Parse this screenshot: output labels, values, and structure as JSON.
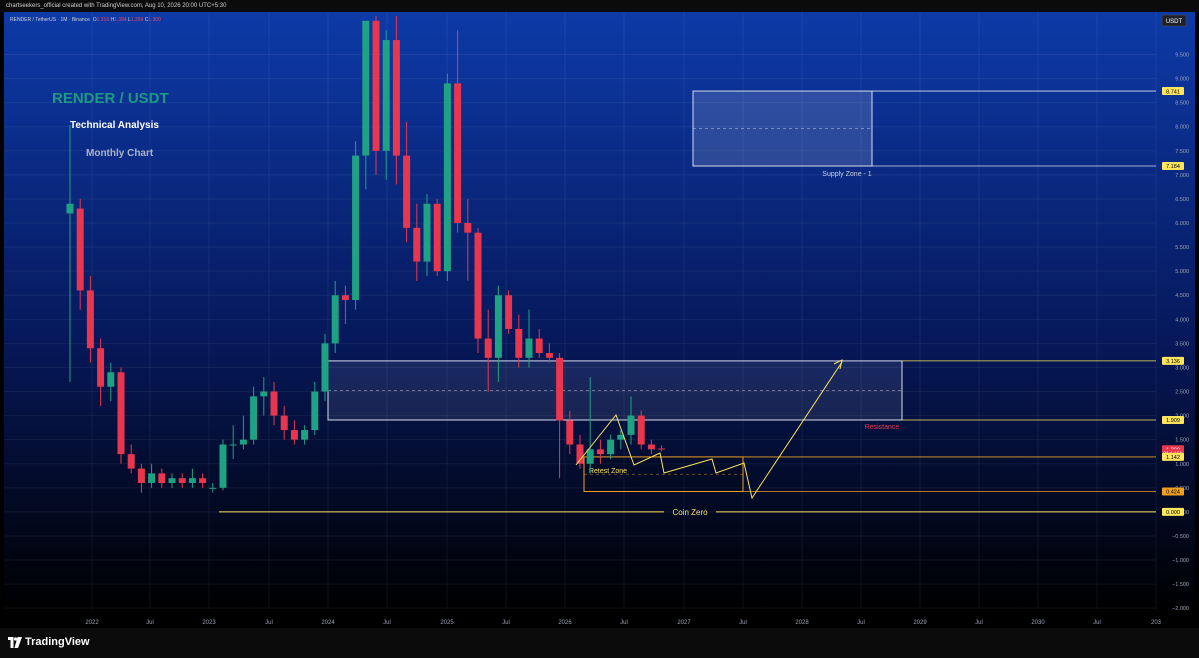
{
  "header": {
    "credit": "chartseekers_official created with TradingView.com, Aug 10, 2026 20:00 UTC+5:30",
    "symbol": "RENDER / TetherUS · 1M · Binance",
    "ohlc": {
      "O": "1.316",
      "H": "1.384",
      "L": "1.259",
      "C": "1.300"
    }
  },
  "overlay": {
    "title": "RENDER / USDT",
    "subtitle": "Technical Analysis",
    "period": "Monthly Chart"
  },
  "footer": {
    "brand": "TradingView"
  },
  "colors": {
    "up": "#1fa183",
    "down": "#e8364f",
    "drawing": "#ffe45c",
    "zone_border": "#d8dcea",
    "bg_top": "#0d3aa8",
    "bg_bottom": "#000000"
  },
  "chart_data": {
    "type": "candlestick",
    "currency_label": "USDT",
    "y_range": [
      -2.1,
      10.3
    ],
    "y_ticks": [
      "9.500",
      "9.000",
      "8.500",
      "8.000",
      "7.500",
      "7.000",
      "6.500",
      "6.000",
      "5.500",
      "5.000",
      "4.500",
      "4.000",
      "3.500",
      "3.000",
      "2.500",
      "2.000",
      "1.500",
      "1.000",
      "0.500",
      "0.000",
      "−0.500",
      "−1.000",
      "−1.500",
      "−2.000"
    ],
    "x_ticks": [
      "2022",
      "Jul",
      "2023",
      "Jul",
      "2024",
      "Jul",
      "2025",
      "Jul",
      "2026",
      "Jul",
      "2027",
      "Jul",
      "2028",
      "Jul",
      "2029",
      "Jul",
      "2030",
      "Jul",
      "203"
    ],
    "candles": [
      {
        "o": 6.2,
        "h": 7.9,
        "l": 2.7,
        "c": 6.4
      },
      {
        "o": 6.3,
        "h": 6.5,
        "l": 4.2,
        "c": 4.6
      },
      {
        "o": 4.6,
        "h": 4.9,
        "l": 3.1,
        "c": 3.4
      },
      {
        "o": 3.4,
        "h": 3.6,
        "l": 2.2,
        "c": 2.6
      },
      {
        "o": 2.6,
        "h": 3.1,
        "l": 2.3,
        "c": 2.9
      },
      {
        "o": 2.9,
        "h": 3.0,
        "l": 1.0,
        "c": 1.2
      },
      {
        "o": 1.2,
        "h": 1.4,
        "l": 0.8,
        "c": 0.9
      },
      {
        "o": 0.9,
        "h": 1.0,
        "l": 0.4,
        "c": 0.6
      },
      {
        "o": 0.6,
        "h": 1.0,
        "l": 0.5,
        "c": 0.8
      },
      {
        "o": 0.8,
        "h": 0.9,
        "l": 0.5,
        "c": 0.6
      },
      {
        "o": 0.6,
        "h": 0.8,
        "l": 0.5,
        "c": 0.7
      },
      {
        "o": 0.7,
        "h": 0.8,
        "l": 0.5,
        "c": 0.6
      },
      {
        "o": 0.6,
        "h": 0.9,
        "l": 0.5,
        "c": 0.7
      },
      {
        "o": 0.7,
        "h": 0.8,
        "l": 0.5,
        "c": 0.6
      },
      {
        "o": 0.5,
        "h": 0.6,
        "l": 0.4,
        "c": 0.5
      },
      {
        "o": 0.5,
        "h": 1.5,
        "l": 0.45,
        "c": 1.4
      },
      {
        "o": 1.4,
        "h": 1.8,
        "l": 1.1,
        "c": 1.4
      },
      {
        "o": 1.4,
        "h": 2.0,
        "l": 1.3,
        "c": 1.5
      },
      {
        "o": 1.5,
        "h": 2.6,
        "l": 1.4,
        "c": 2.4
      },
      {
        "o": 2.4,
        "h": 2.8,
        "l": 2.0,
        "c": 2.5
      },
      {
        "o": 2.5,
        "h": 2.7,
        "l": 1.8,
        "c": 2.0
      },
      {
        "o": 2.0,
        "h": 2.2,
        "l": 1.5,
        "c": 1.7
      },
      {
        "o": 1.7,
        "h": 1.9,
        "l": 1.4,
        "c": 1.5
      },
      {
        "o": 1.5,
        "h": 1.8,
        "l": 1.4,
        "c": 1.7
      },
      {
        "o": 1.7,
        "h": 2.7,
        "l": 1.6,
        "c": 2.5
      },
      {
        "o": 2.5,
        "h": 3.7,
        "l": 2.3,
        "c": 3.5
      },
      {
        "o": 3.5,
        "h": 4.8,
        "l": 3.3,
        "c": 4.5
      },
      {
        "o": 4.5,
        "h": 4.7,
        "l": 3.9,
        "c": 4.4
      },
      {
        "o": 4.4,
        "h": 7.7,
        "l": 4.2,
        "c": 7.4
      },
      {
        "o": 7.4,
        "h": 10.2,
        "l": 6.7,
        "c": 10.2
      },
      {
        "o": 10.2,
        "h": 10.3,
        "l": 7.0,
        "c": 7.5
      },
      {
        "o": 7.5,
        "h": 10.0,
        "l": 6.9,
        "c": 9.8
      },
      {
        "o": 9.8,
        "h": 10.3,
        "l": 6.8,
        "c": 7.4
      },
      {
        "o": 7.4,
        "h": 8.1,
        "l": 5.6,
        "c": 5.9
      },
      {
        "o": 5.9,
        "h": 6.4,
        "l": 4.8,
        "c": 5.2
      },
      {
        "o": 5.2,
        "h": 6.6,
        "l": 4.9,
        "c": 6.4
      },
      {
        "o": 6.4,
        "h": 6.5,
        "l": 4.9,
        "c": 5.0
      },
      {
        "o": 5.0,
        "h": 9.1,
        "l": 4.8,
        "c": 8.9
      },
      {
        "o": 8.9,
        "h": 10.0,
        "l": 5.8,
        "c": 6.0
      },
      {
        "o": 6.0,
        "h": 6.5,
        "l": 4.8,
        "c": 5.8
      },
      {
        "o": 5.8,
        "h": 5.9,
        "l": 3.3,
        "c": 3.6
      },
      {
        "o": 3.6,
        "h": 4.2,
        "l": 2.5,
        "c": 3.2
      },
      {
        "o": 3.2,
        "h": 4.7,
        "l": 2.7,
        "c": 4.5
      },
      {
        "o": 4.5,
        "h": 4.6,
        "l": 3.7,
        "c": 3.8
      },
      {
        "o": 3.8,
        "h": 4.1,
        "l": 3.0,
        "c": 3.2
      },
      {
        "o": 3.2,
        "h": 4.2,
        "l": 3.0,
        "c": 3.6
      },
      {
        "o": 3.6,
        "h": 3.8,
        "l": 3.2,
        "c": 3.3
      },
      {
        "o": 3.3,
        "h": 3.5,
        "l": 3.1,
        "c": 3.2
      },
      {
        "o": 3.2,
        "h": 3.3,
        "l": 0.7,
        "c": 1.9
      },
      {
        "o": 1.9,
        "h": 2.1,
        "l": 1.2,
        "c": 1.4
      },
      {
        "o": 1.4,
        "h": 1.6,
        "l": 0.9,
        "c": 1.0
      },
      {
        "o": 1.0,
        "h": 2.8,
        "l": 0.8,
        "c": 1.3
      },
      {
        "o": 1.3,
        "h": 1.5,
        "l": 1.0,
        "c": 1.2
      },
      {
        "o": 1.2,
        "h": 1.6,
        "l": 1.1,
        "c": 1.5
      },
      {
        "o": 1.5,
        "h": 1.7,
        "l": 1.3,
        "c": 1.6
      },
      {
        "o": 1.6,
        "h": 2.4,
        "l": 1.4,
        "c": 2.0
      },
      {
        "o": 2.0,
        "h": 2.1,
        "l": 1.3,
        "c": 1.4
      },
      {
        "o": 1.4,
        "h": 1.5,
        "l": 1.2,
        "c": 1.3
      },
      {
        "o": 1.316,
        "h": 1.384,
        "l": 1.259,
        "c": 1.3
      }
    ],
    "zones": [
      {
        "name": "Supply Zone - 1",
        "top": 8.741,
        "bottom": 7.184
      },
      {
        "name": "Resistance",
        "top": 3.136,
        "bottom": 1.909
      },
      {
        "name": "Retest Zone",
        "top": 1.142,
        "bottom": 0.424
      }
    ],
    "levels": [
      {
        "label": "Coin Zero",
        "value": 0.0
      }
    ],
    "price_labels": [
      {
        "text": "8.741",
        "value": 8.741,
        "style": "yellow"
      },
      {
        "text": "7.184",
        "value": 7.184,
        "style": "yellow"
      },
      {
        "text": "3.136",
        "value": 3.136,
        "style": "yellow"
      },
      {
        "text": "1.909",
        "value": 1.909,
        "style": "yellow"
      },
      {
        "text": "1.300",
        "value": 1.3,
        "style": "red"
      },
      {
        "text": "21d 15h",
        "value": 1.22,
        "style": "red"
      },
      {
        "text": "1.142",
        "value": 1.142,
        "style": "yellow"
      },
      {
        "text": "0.424",
        "value": 0.424,
        "style": "orange"
      },
      {
        "text": "0.000",
        "value": 0.0,
        "style": "yellow"
      }
    ]
  }
}
